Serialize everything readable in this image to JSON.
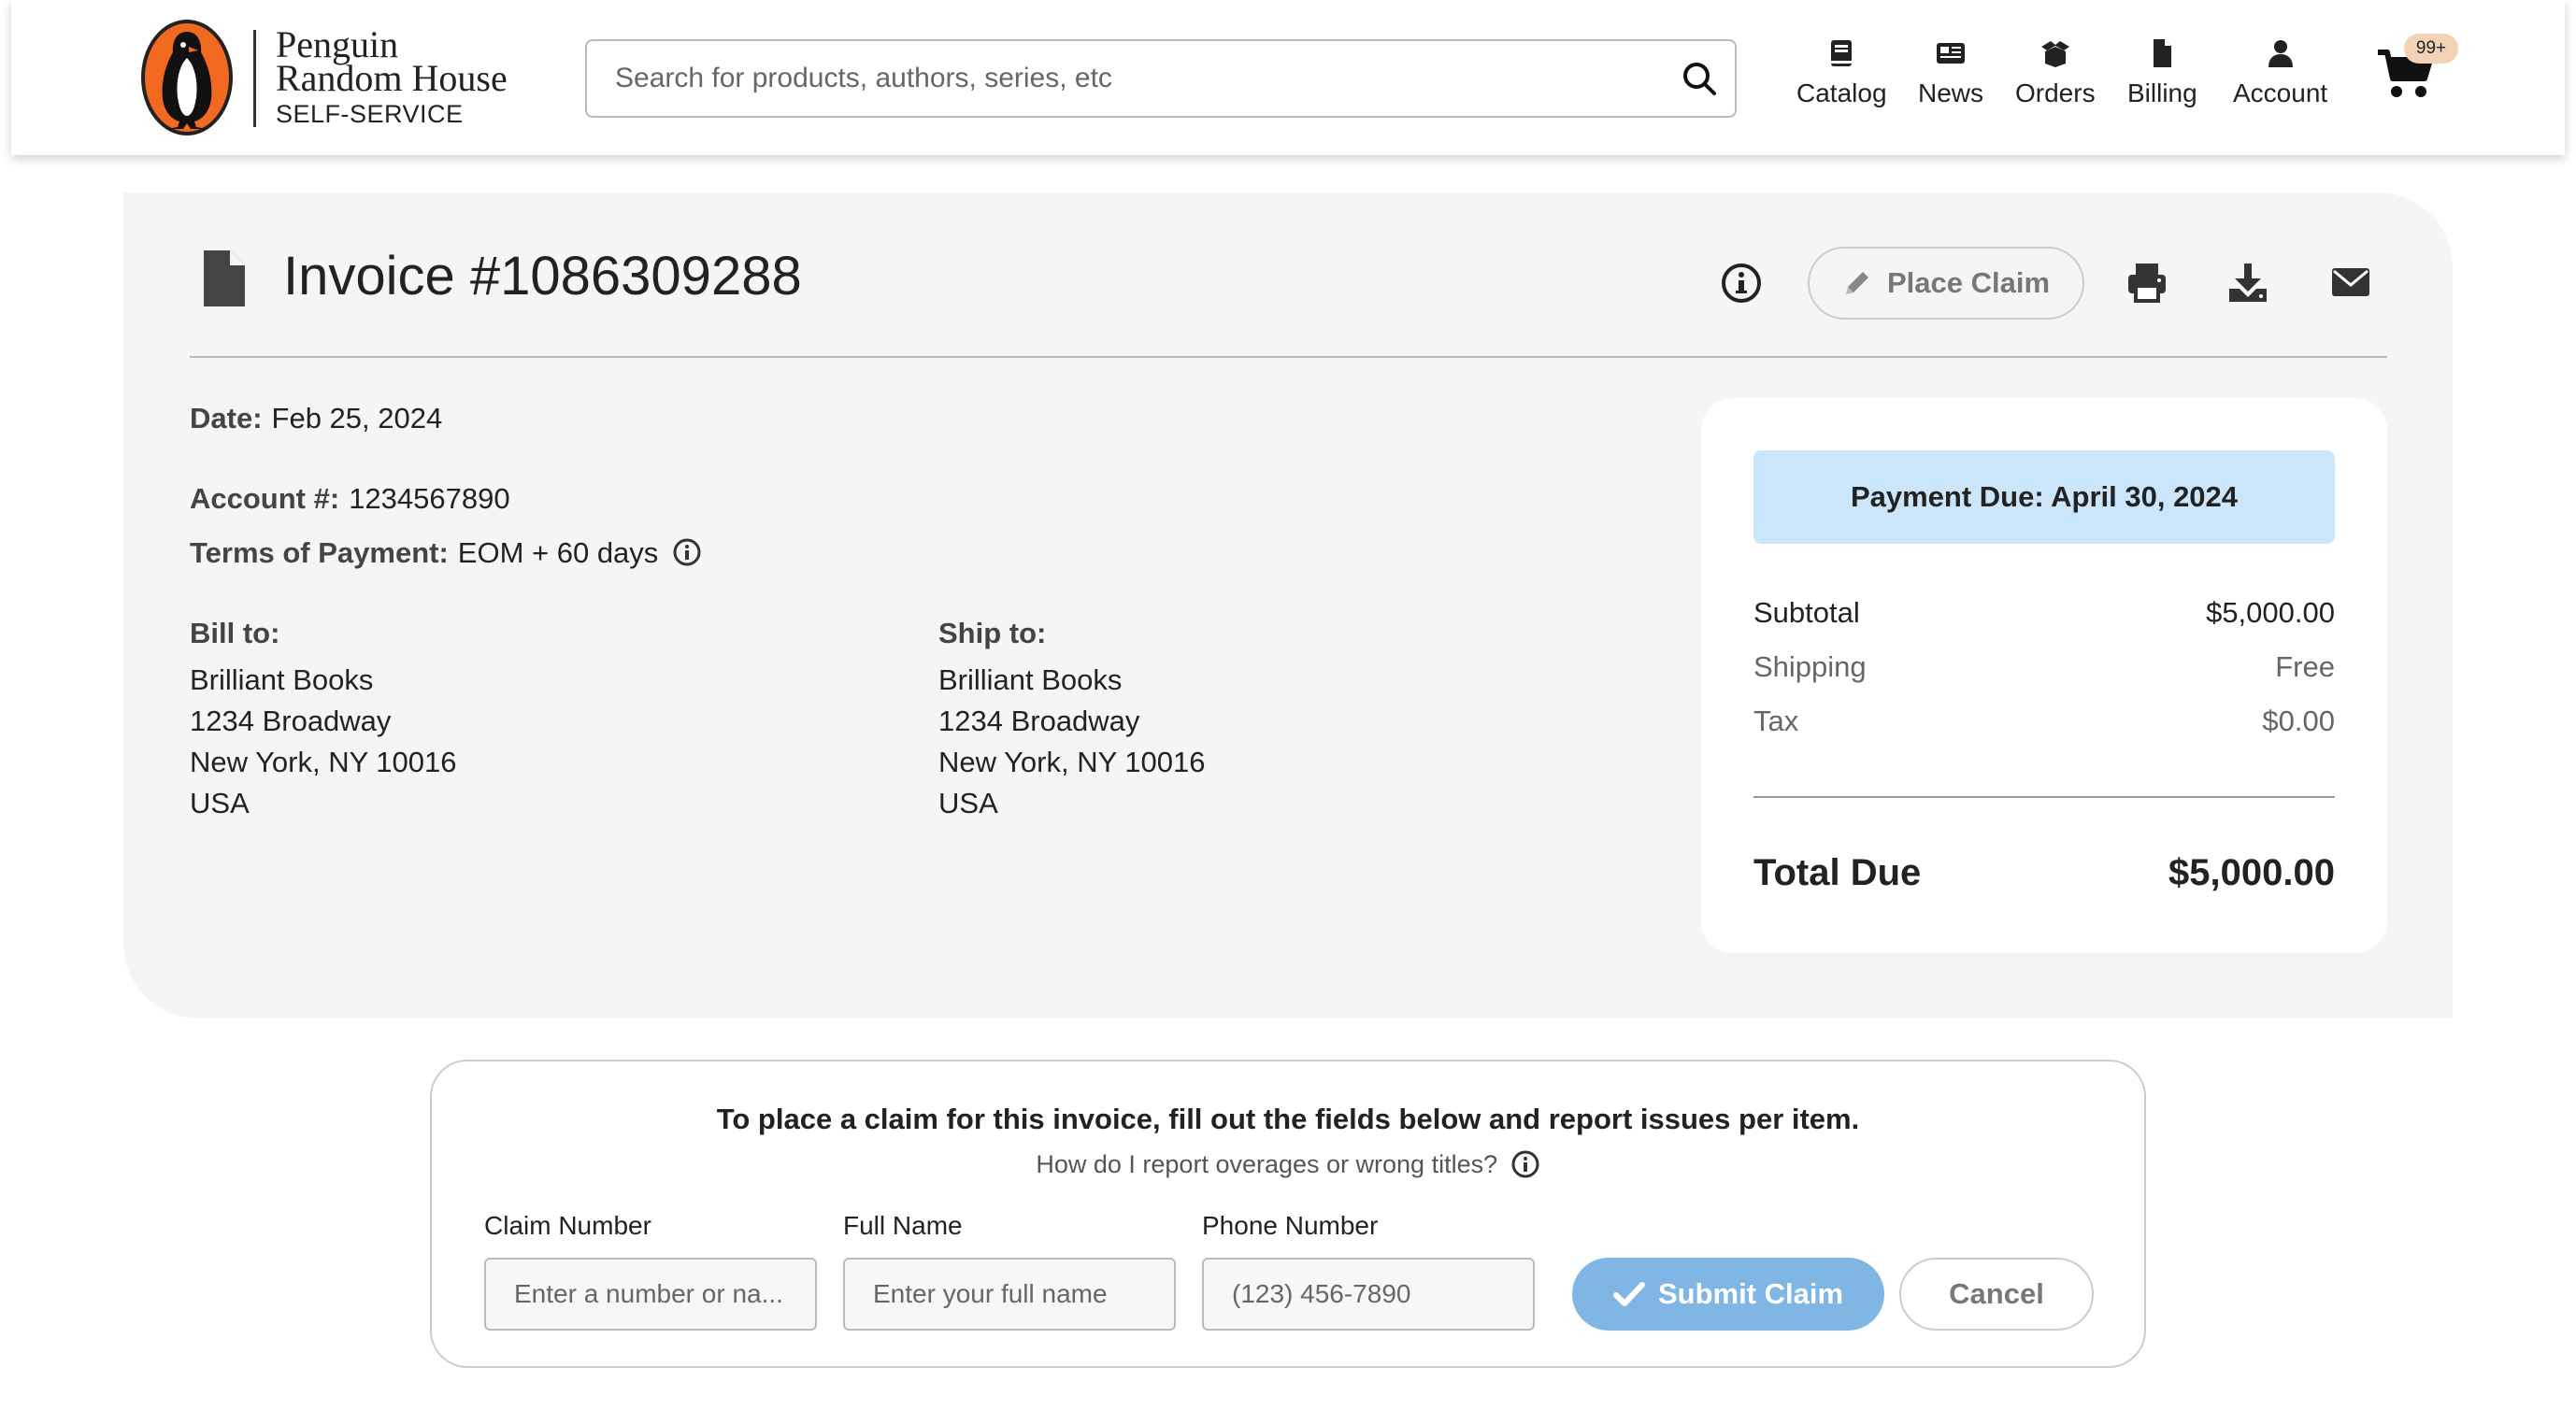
{
  "header": {
    "brand_line1": "Penguin",
    "brand_line2": "Random House",
    "brand_sub": "SELF-SERVICE",
    "search_placeholder": "Search for products, authors, series, etc",
    "nav": [
      {
        "label": "Catalog",
        "icon": "book-icon"
      },
      {
        "label": "News",
        "icon": "newspaper-icon"
      },
      {
        "label": "Orders",
        "icon": "box-open-icon"
      },
      {
        "label": "Billing",
        "icon": "document-icon"
      },
      {
        "label": "Account",
        "icon": "user-icon"
      }
    ],
    "cart_badge": "99+"
  },
  "invoice": {
    "title": "Invoice #1086309288",
    "place_claim_label": "Place Claim",
    "date_label": "Date:",
    "date_value": "Feb 25, 2024",
    "account_label": "Account #:",
    "account_value": "1234567890",
    "terms_label": "Terms of Payment:",
    "terms_value": "EOM + 60 days",
    "bill_to": {
      "heading": "Bill to:",
      "lines": [
        "Brilliant Books",
        "1234 Broadway",
        "New York, NY 10016",
        "USA"
      ]
    },
    "ship_to": {
      "heading": "Ship to:",
      "lines": [
        "Brilliant Books",
        "1234 Broadway",
        "New York, NY 10016",
        "USA"
      ]
    }
  },
  "summary": {
    "payment_due": "Payment Due: April 30, 2024",
    "subtotal_label": "Subtotal",
    "subtotal_value": "$5,000.00",
    "shipping_label": "Shipping",
    "shipping_value": "Free",
    "tax_label": "Tax",
    "tax_value": "$0.00",
    "total_label": "Total Due",
    "total_value": "$5,000.00"
  },
  "claim": {
    "heading": "To place a claim for this invoice, fill out the fields below and report issues per item.",
    "help": "How do I report overages or wrong titles?",
    "claim_number_label": "Claim Number",
    "claim_number_placeholder": "Enter a number or na...",
    "full_name_label": "Full Name",
    "full_name_placeholder": "Enter your full name",
    "phone_label": "Phone Number",
    "phone_placeholder": "(123) 456-7890",
    "submit_label": "Submit Claim",
    "cancel_label": "Cancel"
  },
  "colors": {
    "brand_orange": "#f26a21",
    "due_banner": "#cbe6fb",
    "submit_button": "#7fb6e4",
    "panel_bg": "#f5f5f5"
  }
}
